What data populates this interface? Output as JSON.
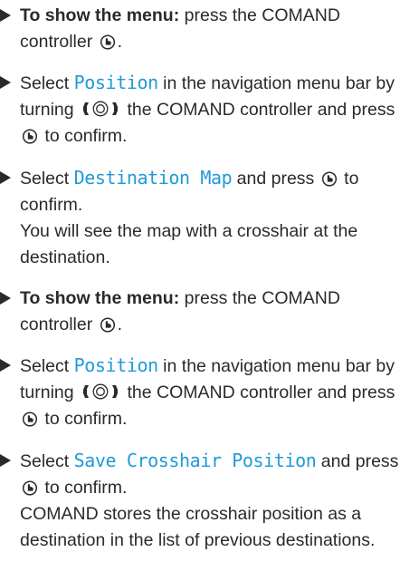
{
  "steps": [
    {
      "bold": "To show the menu:",
      "text": " press the COMAND controller ",
      "end": "."
    },
    {
      "pre": "Select ",
      "code": "Position",
      "mid": " in the navigation menu bar by turning ",
      "mid2": " the COMAND controller and press ",
      "end": " to confirm."
    },
    {
      "pre": "Select ",
      "code": "Destination Map",
      "mid": " and press ",
      "end": " to confirm.",
      "note": "You will see the map with a crosshair at the destination."
    },
    {
      "bold": "To show the menu:",
      "text": " press the COMAND controller ",
      "end": "."
    },
    {
      "pre": "Select ",
      "code": "Position",
      "mid": " in the navigation menu bar by turning ",
      "mid2": " the COMAND controller and press ",
      "end": " to confirm."
    },
    {
      "pre": "Select ",
      "code": "Save Crosshair Position",
      "mid": " and press ",
      "end": " to confirm.",
      "note": "COMAND stores the crosshair position as a destination in the list of previous destinations."
    }
  ],
  "icons": {
    "press": "press-controller-icon",
    "turn": "turn-controller-icon"
  },
  "colors": {
    "text": "#2a2a2a",
    "screen_text": "#1f9ad8"
  }
}
